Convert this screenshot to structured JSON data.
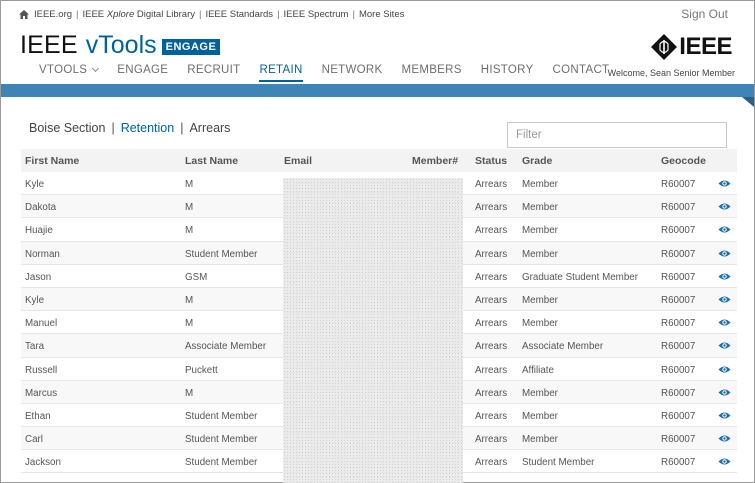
{
  "topbar": {
    "links": [
      "IEEE.org",
      "IEEE Xplore Digital Library",
      "IEEE Standards",
      "IEEE Spectrum",
      "More Sites"
    ],
    "xplore_prefix": "IEEE ",
    "xplore_italic": "Xplore",
    "xplore_suffix": " Digital Library",
    "sign_out": "Sign Out"
  },
  "brand": {
    "ieee": "IEEE",
    "vtools": "vTools",
    "badge": "ENGAGE",
    "logo": "IEEE"
  },
  "welcome": "Welcome, Sean Senior Member",
  "nav": [
    {
      "label": "VTOOLS",
      "dropdown": true
    },
    {
      "label": "ENGAGE"
    },
    {
      "label": "RECRUIT"
    },
    {
      "label": "RETAIN",
      "active": true
    },
    {
      "label": "NETWORK"
    },
    {
      "label": "MEMBERS"
    },
    {
      "label": "HISTORY"
    },
    {
      "label": "CONTACT"
    }
  ],
  "breadcrumb": {
    "section": "Boise Section",
    "retention": "Retention",
    "arrears": "Arrears"
  },
  "filter": {
    "placeholder": "Filter",
    "value": ""
  },
  "table": {
    "headers": [
      "First Name",
      "Last Name",
      "Email",
      "Member#",
      "Status",
      "Grade",
      "Geocode"
    ],
    "rows": [
      [
        "Kyle",
        "M",
        "Arrears",
        "Member",
        "R60007"
      ],
      [
        "Dakota",
        "M",
        "Arrears",
        "Member",
        "R60007"
      ],
      [
        "Huajie",
        "M",
        "Arrears",
        "Member",
        "R60007"
      ],
      [
        "Norman",
        "Student Member",
        "Arrears",
        "Member",
        "R60007"
      ],
      [
        "Jason",
        "GSM",
        "Arrears",
        "Graduate Student Member",
        "R60007"
      ],
      [
        "Kyle",
        "M",
        "Arrears",
        "Member",
        "R60007"
      ],
      [
        "Manuel",
        "M",
        "Arrears",
        "Member",
        "R60007"
      ],
      [
        "Tara",
        "Associate Member",
        "Arrears",
        "Associate Member",
        "R60007"
      ],
      [
        "Russell",
        "Puckett",
        "Arrears",
        "Affiliate",
        "R60007"
      ],
      [
        "Marcus",
        "M",
        "Arrears",
        "Member",
        "R60007"
      ],
      [
        "Ethan",
        "Student Member",
        "Arrears",
        "Member",
        "R60007"
      ],
      [
        "Carl",
        "Student Member",
        "Arrears",
        "Member",
        "R60007"
      ],
      [
        "Jackson",
        "Student Member",
        "Arrears",
        "Student Member",
        "R60007"
      ]
    ]
  },
  "colors": {
    "brand": "#00629b",
    "bar": "#3f84b7"
  }
}
